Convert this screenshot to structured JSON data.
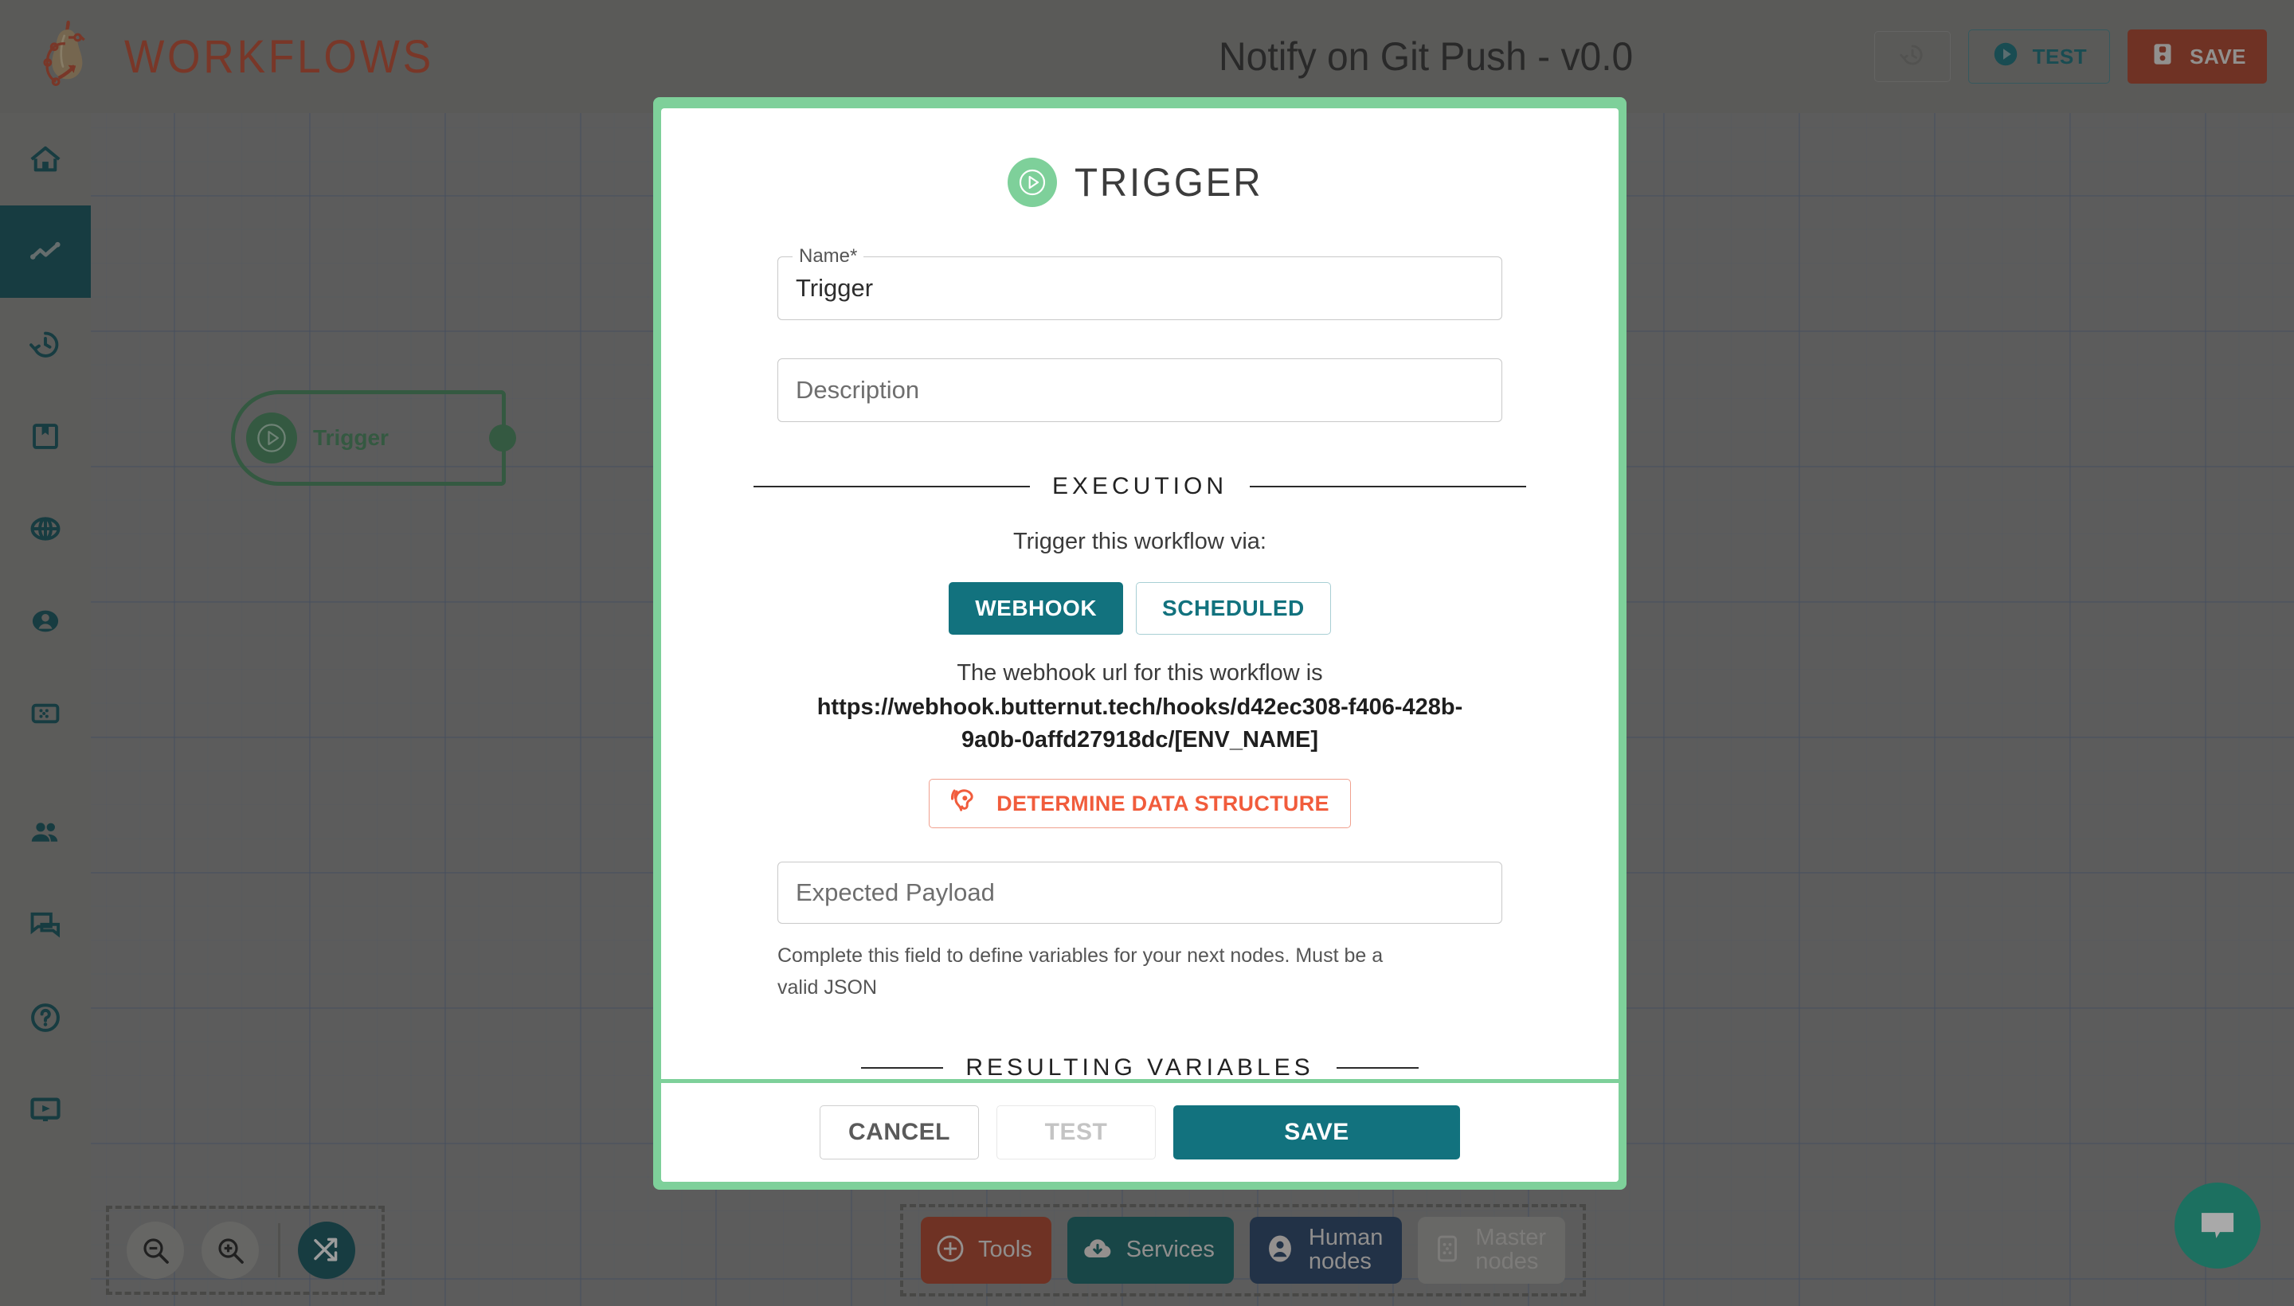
{
  "topbar": {
    "logo_text": "WORKFLOWS",
    "logo_icon": "butternut-squash-workflow-logo",
    "workflow_title": "Notify on Git Push - v0.0",
    "history_icon": "history-icon",
    "test_label": "TEST",
    "test_icon": "play-circle-icon",
    "save_label": "SAVE",
    "save_icon": "floppy-disk-icon"
  },
  "sidebar": {
    "items": [
      {
        "icon": "home-icon",
        "name": "home",
        "active": false
      },
      {
        "icon": "analytics-icon",
        "name": "workflows",
        "active": true
      },
      {
        "icon": "history-icon",
        "name": "history",
        "active": false
      },
      {
        "icon": "book-icon",
        "name": "library",
        "active": false
      },
      {
        "icon": "globe-icon",
        "name": "environments",
        "active": false
      },
      {
        "icon": "account-icon",
        "name": "account",
        "active": false
      },
      {
        "icon": "dashboard-icon",
        "name": "dashboard",
        "active": false
      },
      {
        "icon": "people-icon",
        "name": "team",
        "active": false
      },
      {
        "icon": "forum-icon",
        "name": "messages",
        "active": false
      },
      {
        "icon": "help-icon",
        "name": "help",
        "active": false
      },
      {
        "icon": "tutorial-video-icon",
        "name": "tutorials",
        "active": false
      }
    ]
  },
  "canvas": {
    "node": {
      "label": "Trigger",
      "icon": "play-circle-icon"
    },
    "zoom_controls": {
      "zoom_out_icon": "zoom-out-icon",
      "zoom_in_icon": "zoom-in-icon",
      "rearrange_icon": "shuffle-arrows-icon"
    },
    "palette": [
      {
        "label": "Tools",
        "icon": "plus-circle-icon"
      },
      {
        "label": "Services",
        "icon": "cloud-download-icon"
      },
      {
        "label": "Human\nnodes",
        "icon": "person-circle-icon"
      },
      {
        "label": "Master\nnodes",
        "icon": "master-node-icon"
      }
    ],
    "chat_icon": "chat-bubble-icon"
  },
  "modal": {
    "title": "TRIGGER",
    "title_icon": "play-circle-icon",
    "name_label": "Name",
    "name_required_mark": "*",
    "name_value": "Trigger",
    "description_placeholder": "Description",
    "execution_section": "EXECUTION",
    "trigger_via_text": "Trigger this workflow via:",
    "toggle_webhook": "WEBHOOK",
    "toggle_scheduled": "SCHEDULED",
    "toggle_selected": "WEBHOOK",
    "webhook_url_intro": "The webhook url for this workflow is",
    "webhook_url": "https://webhook.butternut.tech/hooks/d42ec308-f406-428b-9a0b-0affd27918dc/[ENV_NAME]",
    "determine_button": "DETERMINE DATA STRUCTURE",
    "determine_icon": "listening-ear-icon",
    "payload_placeholder": "Expected Payload",
    "payload_helper": "Complete this field to define variables for your next nodes. Must be a valid JSON",
    "resulting_section": "RESULTING VARIABLES",
    "footer": {
      "cancel": "CANCEL",
      "test": "TEST",
      "save": "SAVE"
    }
  },
  "colors": {
    "accent_teal": "#12727e",
    "accent_green": "#7ed09a",
    "accent_red": "#9e3a22",
    "accent_orange": "#f15c3c",
    "node_green": "#3d7a52",
    "chat_green": "#15a086"
  }
}
